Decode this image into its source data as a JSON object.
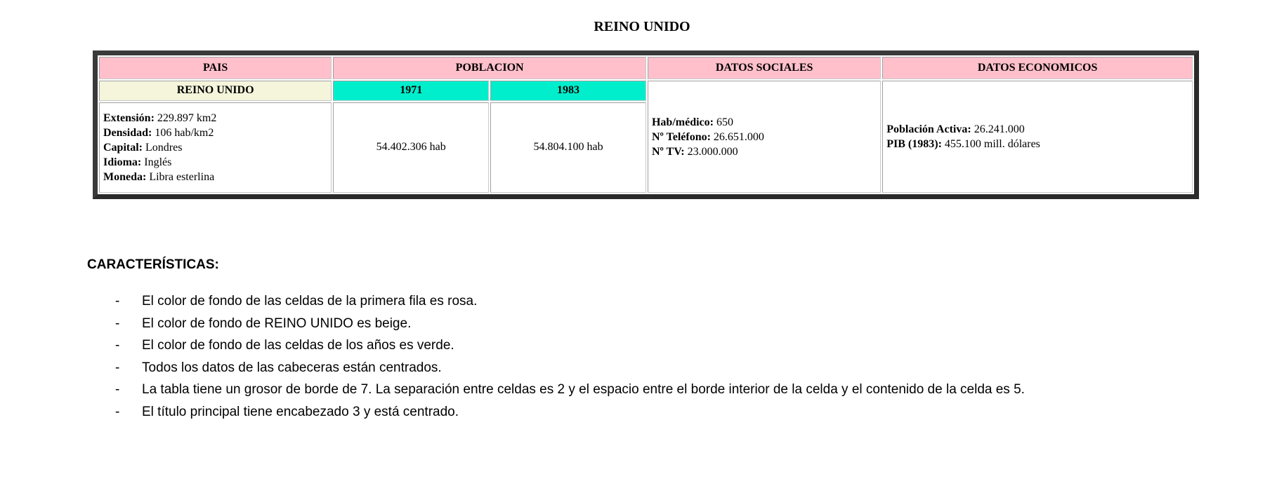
{
  "main_title": "REINO UNIDO",
  "table": {
    "headers": [
      "PAIS",
      "POBLACION",
      "DATOS SOCIALES",
      "DATOS ECONOMICOS"
    ],
    "country": "REINO UNIDO",
    "years": [
      "1971",
      "1983"
    ],
    "country_info": [
      {
        "label": "Extensión:",
        "value": " 229.897 km2"
      },
      {
        "label": "Densidad:",
        "value": " 106 hab/km2"
      },
      {
        "label": "Capital:",
        "value": " Londres"
      },
      {
        "label": "Idioma:",
        "value": " Inglés"
      },
      {
        "label": "Moneda:",
        "value": " Libra esterlina"
      }
    ],
    "population_values": [
      "54.402.306 hab",
      "54.804.100 hab"
    ],
    "social_data": [
      {
        "label": "Hab/médico:",
        "value": " 650"
      },
      {
        "label": "Nº Teléfono:",
        "value": " 26.651.000"
      },
      {
        "label": "Nº TV:",
        "value": " 23.000.000"
      }
    ],
    "economic_data": [
      {
        "label": "Población Activa:",
        "value": " 26.241.000"
      },
      {
        "label": "PIB (1983):",
        "value": " 455.100 mill. dólares"
      }
    ]
  },
  "caracteristicas": {
    "heading": "CARACTERÍSTICAS:",
    "bullet": "-",
    "items": [
      "El color de fondo de las celdas de la primera fila es rosa.",
      "El color de fondo de REINO UNIDO es beige.",
      "El color de fondo de las celdas de los años es verde.",
      "Todos los datos de las cabeceras están centrados.",
      "La tabla tiene un grosor de borde de 7. La separación entre celdas es 2 y el espacio entre el borde interior de la celda y el contenido de la celda es 5.",
      "El título principal tiene encabezado 3 y está centrado."
    ]
  },
  "colors": {
    "header_background": "#ffc0cb",
    "country_background": "#f5f5dc",
    "year_background": "#00eecc",
    "table_border": "#3a3a3a"
  }
}
